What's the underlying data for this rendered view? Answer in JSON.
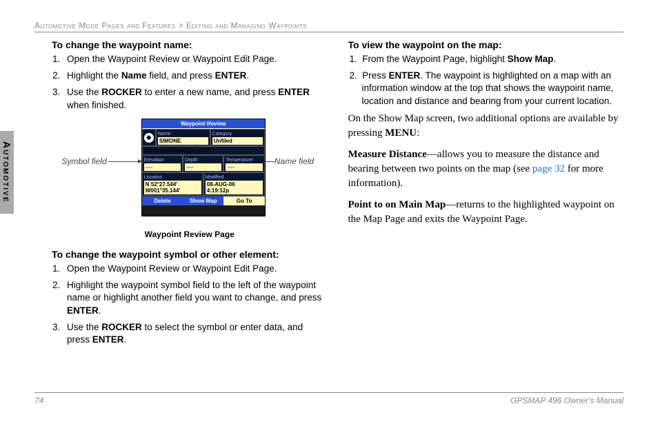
{
  "breadcrumb": "Automotive Mode Pages and Features > Editing and Managing Waypoints",
  "side_tab": "Automotive",
  "left": {
    "h1": "To change the waypoint name:",
    "s1": [
      "Open the Waypoint Review or Waypoint Edit Page.",
      [
        "Highlight the ",
        "Name",
        " field, and press ",
        "ENTER",
        "."
      ],
      [
        "Use the ",
        "ROCKER",
        " to enter a new name, and press ",
        "ENTER",
        " when finished."
      ]
    ],
    "callout_left": "Symbol field",
    "callout_right": "Name field",
    "figcap": "Waypoint Review Page",
    "h2": "To change the waypoint symbol or other element:",
    "s2": [
      "Open the Waypoint Review or Waypoint Edit Page.",
      [
        "Highlight the waypoint symbol field to the left of the waypoint name or highlight another field you want to change, and press ",
        "ENTER",
        "."
      ],
      [
        "Use the ",
        "ROCKER",
        " to select the symbol or enter data, and press ",
        "ENTER",
        "."
      ]
    ]
  },
  "device": {
    "title": "Waypoint Review",
    "name_lbl": "Name",
    "name_val": "SIMONE",
    "cat_lbl": "Category",
    "cat_val": "Unfiled",
    "comment_lbl": "Comment",
    "comment_val": "08-AUG-06 10:19",
    "elev_lbl": "Elevation",
    "elev_val": "----",
    "depth_lbl": "Depth",
    "depth_val": "----",
    "temp_lbl": "Temperature",
    "temp_val": "----",
    "loc_lbl": "Location",
    "loc_val1": "N 52°27.544'",
    "loc_val2": "W001°35.144'",
    "mod_lbl": "Modified",
    "mod_val1": "08-AUG-06",
    "mod_val2": "4:19:12p",
    "btn1": "Delete",
    "btn2": "Show Map",
    "btn3": "Go To"
  },
  "right": {
    "h1": "To view the waypoint on the map:",
    "s1": [
      [
        "From the Waypoint Page, highlight ",
        "Show Map",
        "."
      ],
      [
        "Press ",
        "ENTER",
        ". The waypoint is highlighted on a map with an information window at the top that shows the waypoint name, location and distance and bearing from your current location."
      ]
    ],
    "p1a": "On the Show Map screen, two additional options are available by pressing ",
    "p1b": "MENU",
    "p1c": ":",
    "p2a": "Measure Distance",
    "p2b": "—allows you to measure the distance and bearing between two points on the map (see ",
    "p2link": "page 32",
    "p2c": " for more information).",
    "p3a": "Point to on Main Map",
    "p3b": "—returns to the highlighted waypoint on the Map Page and exits the Waypoint Page."
  },
  "footer": {
    "page": "74",
    "title": "GPSMAP 496 Owner's Manual"
  }
}
